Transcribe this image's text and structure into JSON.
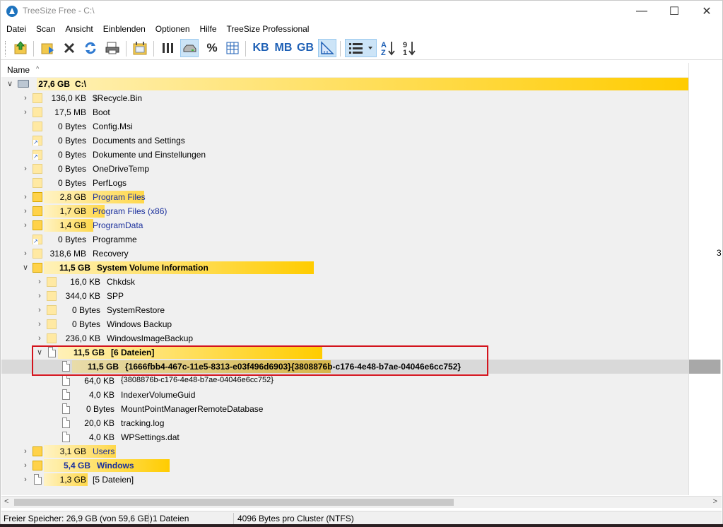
{
  "window": {
    "title": "TreeSize Free - C:\\",
    "minimize": "—",
    "maximize": "☐",
    "close": "✕"
  },
  "menu": [
    "Datei",
    "Scan",
    "Ansicht",
    "Einblenden",
    "Optionen",
    "Hilfe",
    "TreeSize Professional"
  ],
  "toolbar": {
    "icons": [
      "scan-folder-icon",
      "select-directory-icon",
      "close-icon",
      "refresh-icon",
      "print-icon",
      "calendar-icon",
      "columns-icon",
      "drive-icon",
      "percent-icon",
      "grid-icon",
      "kb-icon",
      "mb-icon",
      "gb-icon",
      "chart-icon",
      "list-view-icon",
      "sort-alpha-icon",
      "sort-size-icon"
    ],
    "percent": "%",
    "kb": "KB",
    "mb": "MB",
    "gb": "GB"
  },
  "header": {
    "name": "Name",
    "sort_arrow": "^"
  },
  "tree": [
    {
      "size": "27,6 GB",
      "name": "C:\\"
    },
    {
      "size": "136,0 KB",
      "name": "$Recycle.Bin"
    },
    {
      "size": "17,5 MB",
      "name": "Boot"
    },
    {
      "size": "0 Bytes",
      "name": "Config.Msi"
    },
    {
      "size": "0 Bytes",
      "name": "Documents and Settings"
    },
    {
      "size": "0 Bytes",
      "name": "Dokumente und Einstellungen"
    },
    {
      "size": "0 Bytes",
      "name": "OneDriveTemp"
    },
    {
      "size": "0 Bytes",
      "name": "PerfLogs"
    },
    {
      "size": "2,8 GB",
      "name": "Program Files"
    },
    {
      "size": "1,7 GB",
      "name": "Program Files (x86)"
    },
    {
      "size": "1,4 GB",
      "name": "ProgramData"
    },
    {
      "size": "0 Bytes",
      "name": "Programme"
    },
    {
      "size": "318,6 MB",
      "name": "Recovery"
    },
    {
      "size": "11,5 GB",
      "name": "System Volume Information"
    },
    {
      "size": "16,0 KB",
      "name": "Chkdsk"
    },
    {
      "size": "344,0 KB",
      "name": "SPP"
    },
    {
      "size": "0 Bytes",
      "name": "SystemRestore"
    },
    {
      "size": "0 Bytes",
      "name": "Windows Backup"
    },
    {
      "size": "236,0 KB",
      "name": "WindowsImageBackup"
    },
    {
      "size": "11,5 GB",
      "name": "[6 Dateien]"
    },
    {
      "size": "11,5 GB",
      "name": "{1666fbb4-467c-11e5-8313-e03f496d6903}{3808876b-c176-4e48-b7ae-04046e6cc752}"
    },
    {
      "size": "64,0 KB",
      "name": "{3808876b-c176-4e48-b7ae-04046e6cc752}"
    },
    {
      "size": "4,0 KB",
      "name": "IndexerVolumeGuid"
    },
    {
      "size": "0 Bytes",
      "name": "MountPointManagerRemoteDatabase"
    },
    {
      "size": "20,0 KB",
      "name": "tracking.log"
    },
    {
      "size": "4,0 KB",
      "name": "WPSettings.dat"
    },
    {
      "size": "3,1 GB",
      "name": "Users"
    },
    {
      "size": "5,4 GB",
      "name": "Windows"
    },
    {
      "size": "1,3 GB",
      "name": "[5 Dateien]"
    }
  ],
  "right_column": {
    "partial_value": "3"
  },
  "scrollbar": {
    "left": "<",
    "right": ">"
  },
  "status": {
    "free": "Freier Speicher: 26,9 GB  (von 59,6 GB)",
    "files": "1  Dateien",
    "cluster": "4096 Bytes pro Cluster (NTFS)"
  },
  "colors": {
    "bar_light": "#fff3c4",
    "bar_strong": "#ffcc00",
    "folder": "#ffe9a3",
    "link_blue": "#1a2f9c",
    "highlight_border": "#d3141d",
    "selection": "#d9d9d9"
  }
}
